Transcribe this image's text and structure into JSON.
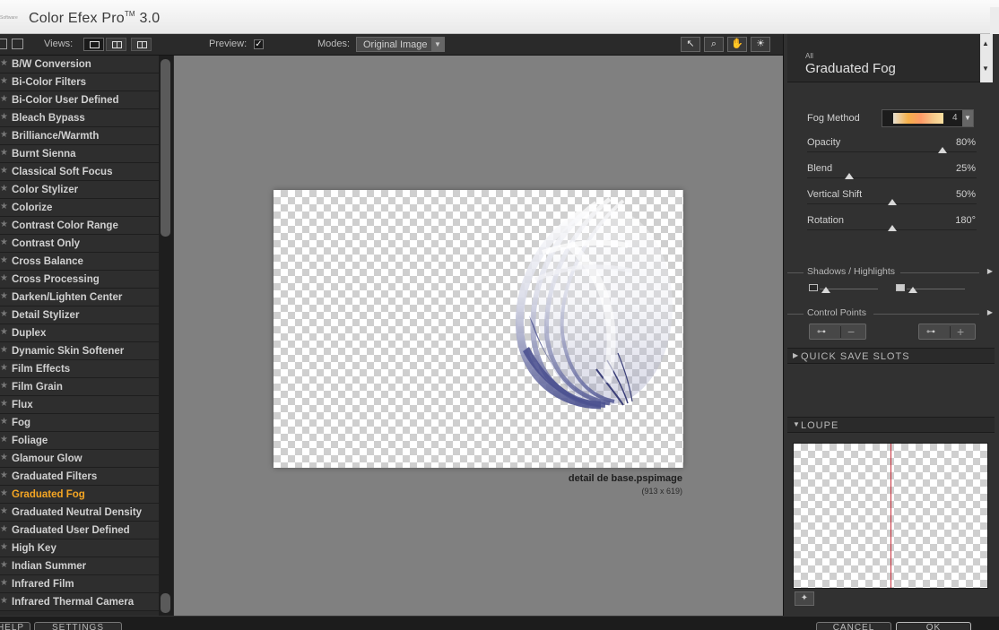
{
  "titlebar": {
    "app_title": "Color Efex Pro",
    "tm": "TM",
    "version": "3.0",
    "logo_text": "Software"
  },
  "toolbar": {
    "views_label": "Views:",
    "preview_label": "Preview:",
    "preview_checked": "✓",
    "modes_label": "Modes:",
    "modes_value": "Original Image"
  },
  "filters": [
    "B/W Conversion",
    "Bi-Color Filters",
    "Bi-Color User Defined",
    "Bleach Bypass",
    "Brilliance/Warmth",
    "Burnt Sienna",
    "Classical Soft Focus",
    "Color Stylizer",
    "Colorize",
    "Contrast Color Range",
    "Contrast Only",
    "Cross Balance",
    "Cross Processing",
    "Darken/Lighten Center",
    "Detail Stylizer",
    "Duplex",
    "Dynamic Skin Softener",
    "Film Effects",
    "Film Grain",
    "Flux",
    "Fog",
    "Foliage",
    "Glamour Glow",
    "Graduated Filters",
    "Graduated Fog",
    "Graduated Neutral Density",
    "Graduated User Defined",
    "High Key",
    "Indian Summer",
    "Infrared Film",
    "Infrared Thermal Camera"
  ],
  "selected_filter_index": 24,
  "preview": {
    "filename": "detail de base.pspimage",
    "dimensions": "(913 x 619)"
  },
  "panel": {
    "category": "All",
    "filter_name": "Graduated Fog",
    "fog_method_label": "Fog Method",
    "fog_method_value": "4",
    "params": [
      {
        "label": "Opacity",
        "value": "80%",
        "fraction": 0.8
      },
      {
        "label": "Blend",
        "value": "25%",
        "fraction": 0.25
      },
      {
        "label": "Vertical Shift",
        "value": "50%",
        "fraction": 0.5
      },
      {
        "label": "Rotation",
        "value": "180°",
        "fraction": 0.5
      }
    ],
    "shadows_highlights": "Shadows / Highlights",
    "control_points": "Control Points",
    "quick_save": "QUICK SAVE SLOTS",
    "loupe": "LOUPE"
  },
  "bottom": {
    "help": "HELP",
    "settings": "SETTINGS",
    "cancel": "CANCEL",
    "ok": "OK"
  },
  "colors": {
    "selected": "#f5a623",
    "loupe_line": "#c8303c",
    "fog_blue": "#5a5f96"
  }
}
